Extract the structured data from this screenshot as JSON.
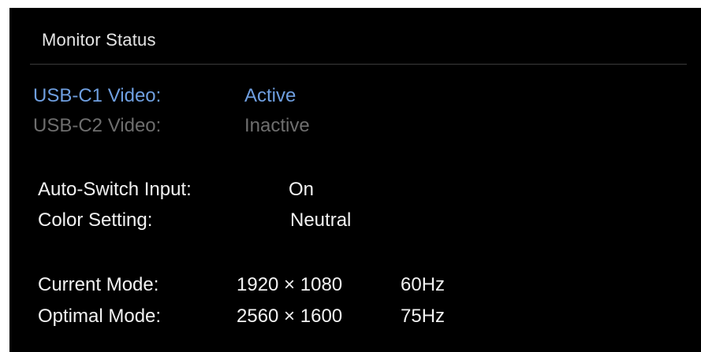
{
  "panel": {
    "title": "Monitor Status"
  },
  "video_inputs": [
    {
      "label": "USB-C1 Video:",
      "value": "Active",
      "state_color": "#6f9fe0"
    },
    {
      "label": "USB-C2 Video:",
      "value": "Inactive",
      "state_color": "#6e6e6e"
    }
  ],
  "settings": [
    {
      "label": "Auto-Switch Input:",
      "value": "On"
    },
    {
      "label": "Color Setting:",
      "value": "Neutral"
    }
  ],
  "modes": [
    {
      "label": "Current Mode:",
      "resolution": "1920 × 1080",
      "refresh": "60Hz"
    },
    {
      "label": "Optimal Mode:",
      "resolution": "2560 × 1600",
      "refresh": "75Hz"
    }
  ]
}
